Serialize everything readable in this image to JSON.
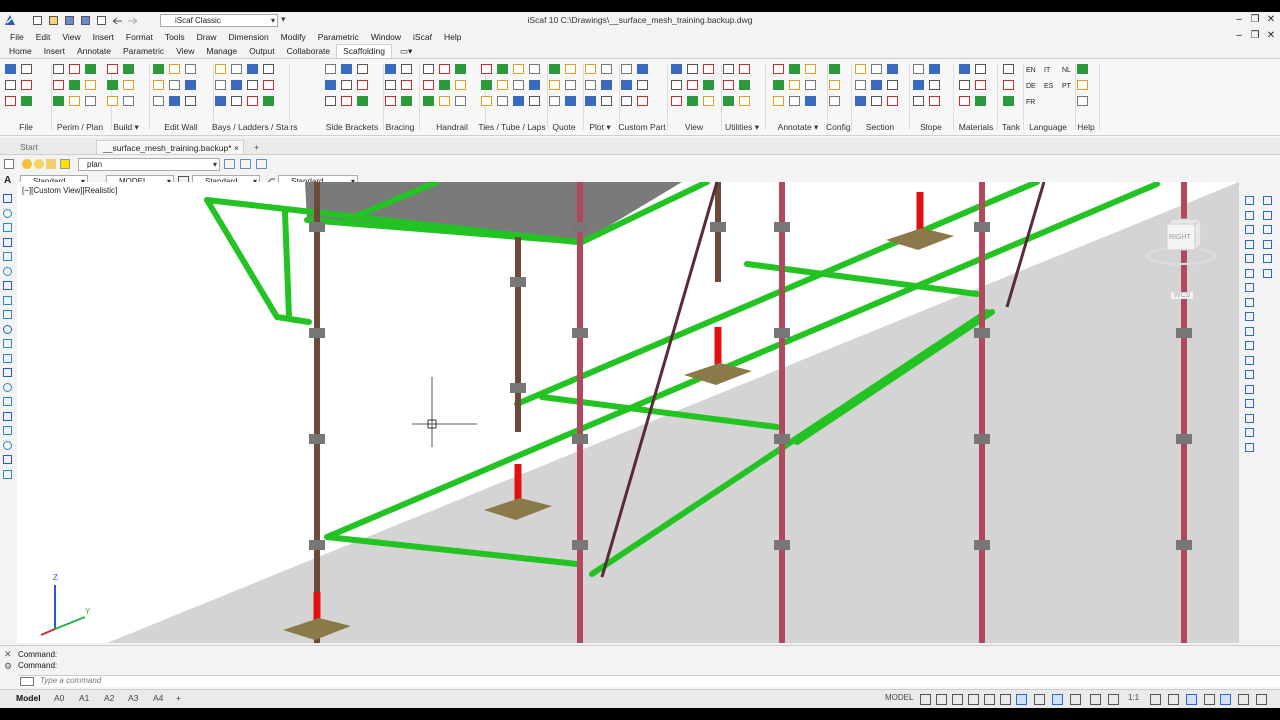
{
  "app": {
    "title": "iScaf 10    C:\\Drawings\\__surface_mesh_training.backup.dwg",
    "workspace": "iScaf Classic"
  },
  "menu": [
    "File",
    "Edit",
    "View",
    "Insert",
    "Format",
    "Tools",
    "Draw",
    "Dimension",
    "Modify",
    "Parametric",
    "Window",
    "iScaf",
    "Help"
  ],
  "ribbon_tabs": [
    "Home",
    "Insert",
    "Annotate",
    "Parametric",
    "View",
    "Manage",
    "Output",
    "Collaborate",
    "Scaffolding"
  ],
  "active_ribbon_tab": "Scaffolding",
  "panels": [
    {
      "label": "File"
    },
    {
      "label": "Perim / Plan"
    },
    {
      "label": "Build ▾"
    },
    {
      "label": "Edit Wall"
    },
    {
      "label": "Bays / Ladders / Stairs"
    },
    {
      "label": "Side Brackets"
    },
    {
      "label": "Bracing"
    },
    {
      "label": "Handrail"
    },
    {
      "label": "Ties / Tube / Laps"
    },
    {
      "label": "Quote"
    },
    {
      "label": "Plot ▾"
    },
    {
      "label": "Custom Part"
    },
    {
      "label": "View"
    },
    {
      "label": "Utilities ▾"
    },
    {
      "label": "Annotate ▾"
    },
    {
      "label": "Config"
    },
    {
      "label": "Section"
    },
    {
      "label": "Slope"
    },
    {
      "label": "Materials"
    },
    {
      "label": "Tank"
    },
    {
      "label": "Language"
    },
    {
      "label": "Help"
    }
  ],
  "languages": [
    "EN",
    "IT",
    "NL",
    "DE",
    "ES",
    "PT",
    "FR"
  ],
  "doc_tabs": {
    "start": "Start",
    "active": "__surface_mesh_training.backup*",
    "close": "×",
    "add": "+"
  },
  "layer": "plan",
  "style_bar": {
    "text_style": "Standard",
    "space": "MODEL",
    "dim_style": "Standard",
    "table_style": "Standard"
  },
  "viewport": {
    "label": "[−][Custom View][Realistic]",
    "viewcube": "RIGHT",
    "wcs": "WCS",
    "axis_z": "Z",
    "axis_y": "Y"
  },
  "command": {
    "line1": "Command:",
    "line2": "Command:",
    "placeholder": "Type a command"
  },
  "layout_tabs": [
    "Model",
    "A0",
    "A1",
    "A2",
    "A3",
    "A4"
  ],
  "layout_add": "+",
  "status": {
    "model": "MODEL",
    "scale": "1:1"
  },
  "colors": {
    "ledger": "#22c322",
    "standard_brown": "#6b4a3a",
    "standard_pink": "#b0485e",
    "jack": "#e01010",
    "baseplate": "#8a7a4a",
    "deck": "#7a7a7a",
    "ground": "#d4d4d4"
  }
}
